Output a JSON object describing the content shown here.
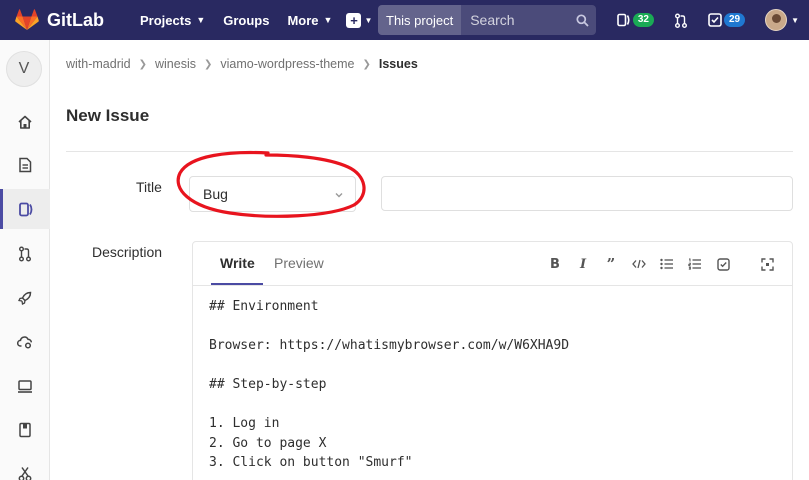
{
  "app": {
    "name": "GitLab"
  },
  "navbar": {
    "projects_label": "Projects",
    "groups_label": "Groups",
    "more_label": "More",
    "search_scope": "This project",
    "search_placeholder": "Search",
    "issues_count": "32",
    "todos_count": "29"
  },
  "sidebar": {
    "project_initial": "V",
    "items": [
      {
        "icon": "home-icon"
      },
      {
        "icon": "repository-icon"
      },
      {
        "icon": "issues-icon",
        "active": true
      },
      {
        "icon": "merge-requests-icon"
      },
      {
        "icon": "ci-cd-icon"
      },
      {
        "icon": "operations-icon"
      },
      {
        "icon": "environments-icon"
      },
      {
        "icon": "wiki-icon"
      },
      {
        "icon": "snippets-icon"
      }
    ]
  },
  "breadcrumb": {
    "items": [
      "with-madrid",
      "winesis",
      "viamo-wordpress-theme"
    ],
    "current": "Issues"
  },
  "page": {
    "title": "New Issue",
    "title_label": "Title",
    "template_value": "Bug",
    "title_value": "",
    "description_label": "Description"
  },
  "editor": {
    "write_tab": "Write",
    "preview_tab": "Preview",
    "toolbar": [
      "bold-icon",
      "italic-icon",
      "quote-icon",
      "code-icon",
      "bullet-list-icon",
      "numbered-list-icon",
      "task-list-icon",
      "fullscreen-icon"
    ],
    "content": "## Environment\n\nBrowser: https://whatismybrowser.com/w/W6XHA9D\n\n## Step-by-step\n\n1. Log in\n2. Go to page X\n3. Click on button \"Smurf\""
  },
  "colors": {
    "navbar": "#292961",
    "accent": "#4b4ba3",
    "annotation": "#e8141e"
  }
}
